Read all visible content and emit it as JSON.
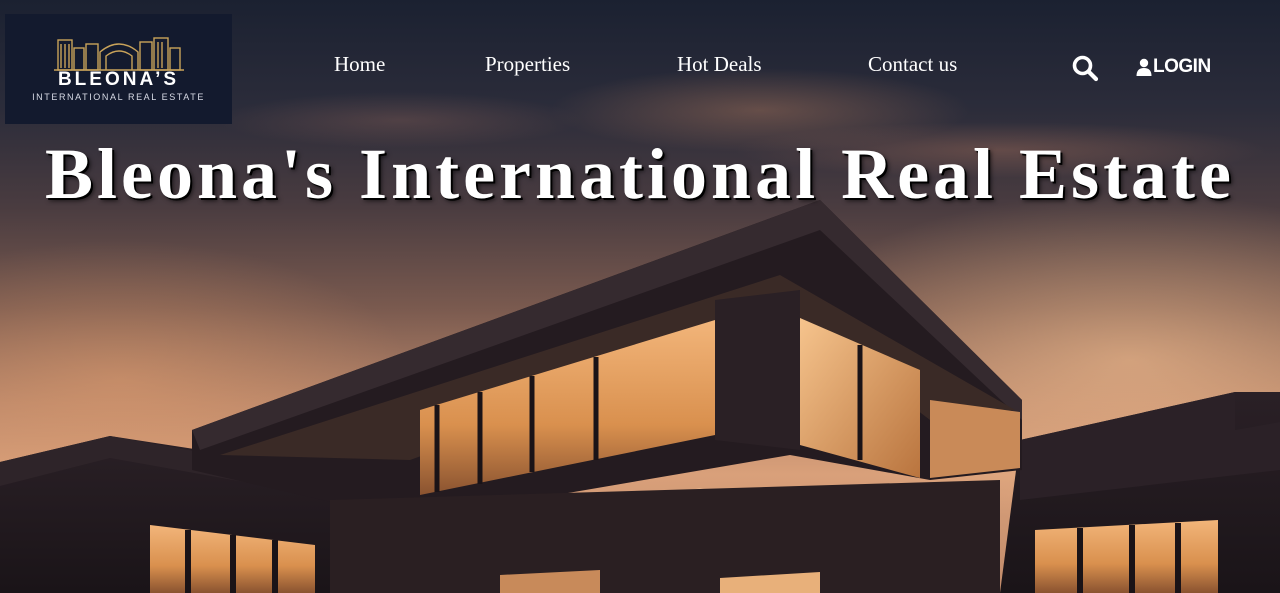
{
  "logo": {
    "name": "BLEONA’S",
    "subtitle": "INTERNATIONAL REAL ESTATE",
    "accent_color": "#c9a35a",
    "background_color": "#131a2e"
  },
  "nav": {
    "items": [
      {
        "label": "Home"
      },
      {
        "label": "Properties"
      },
      {
        "label": "Hot Deals"
      },
      {
        "label": "Contact us"
      }
    ],
    "search_icon": "search-icon",
    "login_icon": "user-icon",
    "login_label": "LOGIN"
  },
  "hero": {
    "title": "Bleona's International Real Estate"
  },
  "colors": {
    "nav_text": "#ffffff",
    "title_text": "#ffffff"
  }
}
